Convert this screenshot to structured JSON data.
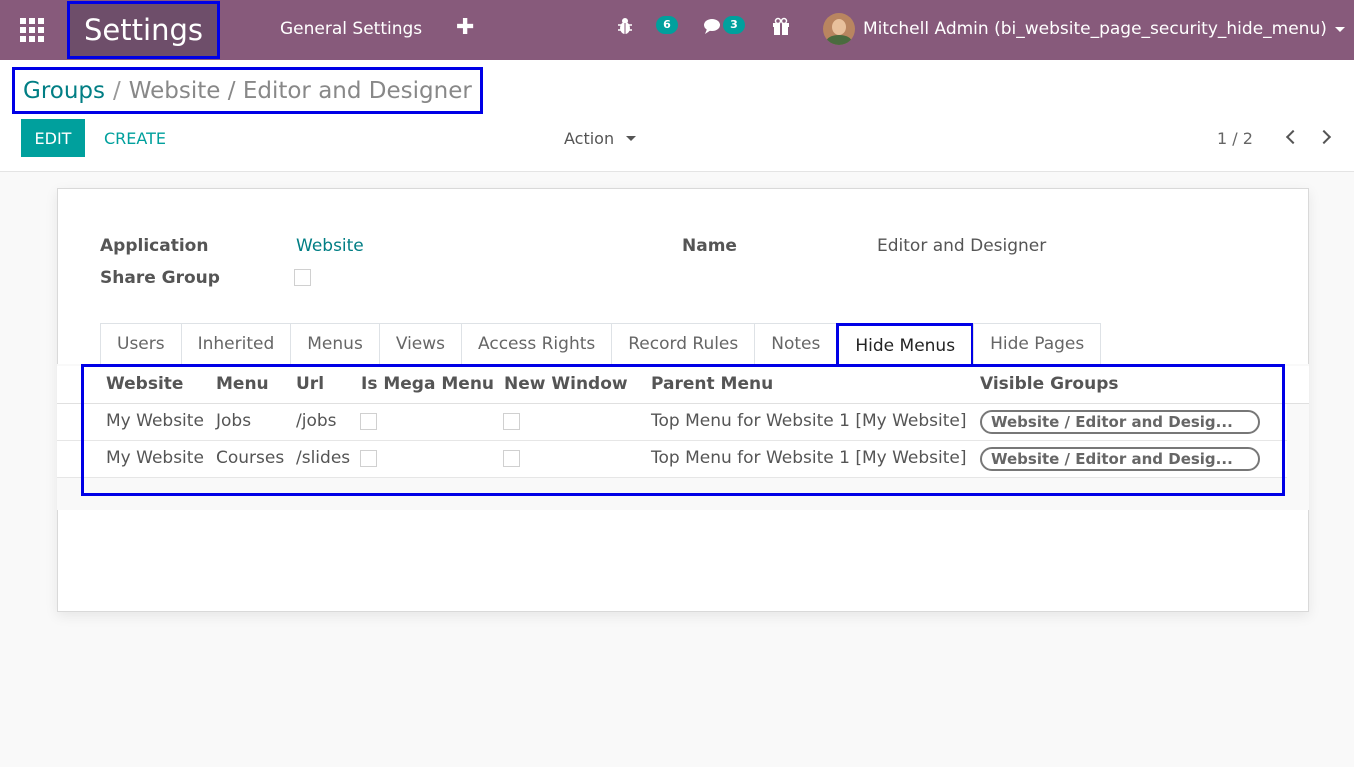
{
  "navbar": {
    "app_title": "Settings",
    "menu_item": "General Settings",
    "plus_label": "✚",
    "debug_badge": "6",
    "chat_badge": "3",
    "user_name": "Mitchell Admin (bi_website_page_security_hide_menu)",
    "bg_color": "#875a7b"
  },
  "breadcrumb": {
    "parent": "Groups",
    "separator": "/",
    "current": "Website / Editor and Designer"
  },
  "toolbar": {
    "edit_label": "EDIT",
    "create_label": "CREATE",
    "action_label": "Action",
    "pager": "1 / 2"
  },
  "form": {
    "application_label": "Application",
    "application_value": "Website",
    "share_group_label": "Share Group",
    "name_label": "Name",
    "name_value": "Editor and Designer"
  },
  "tabs": [
    {
      "label": "Users"
    },
    {
      "label": "Inherited"
    },
    {
      "label": "Menus"
    },
    {
      "label": "Views"
    },
    {
      "label": "Access Rights"
    },
    {
      "label": "Record Rules"
    },
    {
      "label": "Notes"
    },
    {
      "label": "Hide Menus",
      "active": true
    },
    {
      "label": "Hide Pages"
    }
  ],
  "table": {
    "headers": [
      "Website",
      "Menu",
      "Url",
      "Is Mega Menu",
      "New Window",
      "Parent Menu",
      "Visible Groups"
    ],
    "rows": [
      {
        "website": "My Website",
        "menu": "Jobs",
        "url": "/jobs",
        "parent": "Top Menu for Website 1 [My Website]",
        "group": "Website / Editor and Desig..."
      },
      {
        "website": "My Website",
        "menu": "Courses",
        "url": "/slides",
        "parent": "Top Menu for Website 1 [My Website]",
        "group": "Website / Editor and Desig..."
      }
    ]
  }
}
